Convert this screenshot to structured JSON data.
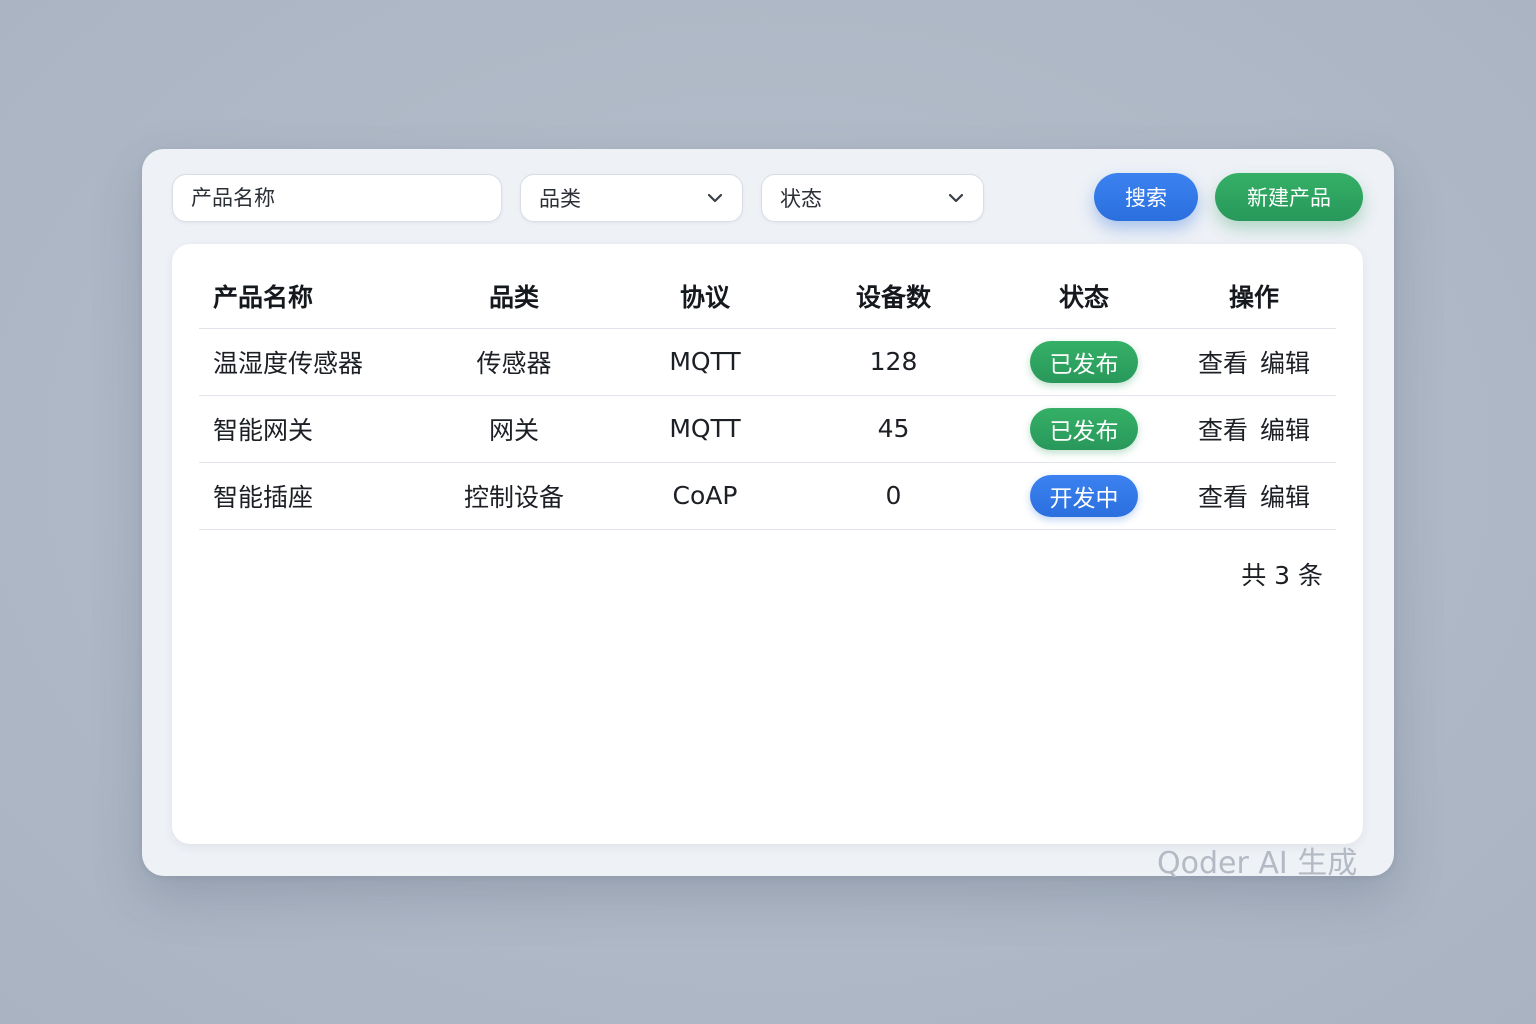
{
  "filters": {
    "name_placeholder": "产品名称",
    "category_placeholder": "品类",
    "status_placeholder": "状态",
    "search_label": "搜索",
    "create_label": "新建产品"
  },
  "table": {
    "headers": [
      "产品名称",
      "品类",
      "协议",
      "设备数",
      "状态",
      "操作"
    ],
    "rows": [
      {
        "name": "温湿度传感器",
        "category": "传感器",
        "protocol": "MQTT",
        "devices": "128",
        "status": "已发布",
        "status_color": "#2fa862",
        "view": "查看",
        "edit": "编辑"
      },
      {
        "name": "智能网关",
        "category": "网关",
        "protocol": "MQTT",
        "devices": "45",
        "status": "已发布",
        "status_color": "#2fa862",
        "view": "查看",
        "edit": "编辑"
      },
      {
        "name": "智能插座",
        "category": "控制设备",
        "protocol": "CoAP",
        "devices": "0",
        "status": "开发中",
        "status_color": "#3379e8",
        "view": "查看",
        "edit": "编辑"
      }
    ],
    "total_label": "共 3 条"
  },
  "watermark": "Qoder AI 生成",
  "colors": {
    "primary": "#3379e8",
    "success": "#2fa862"
  }
}
